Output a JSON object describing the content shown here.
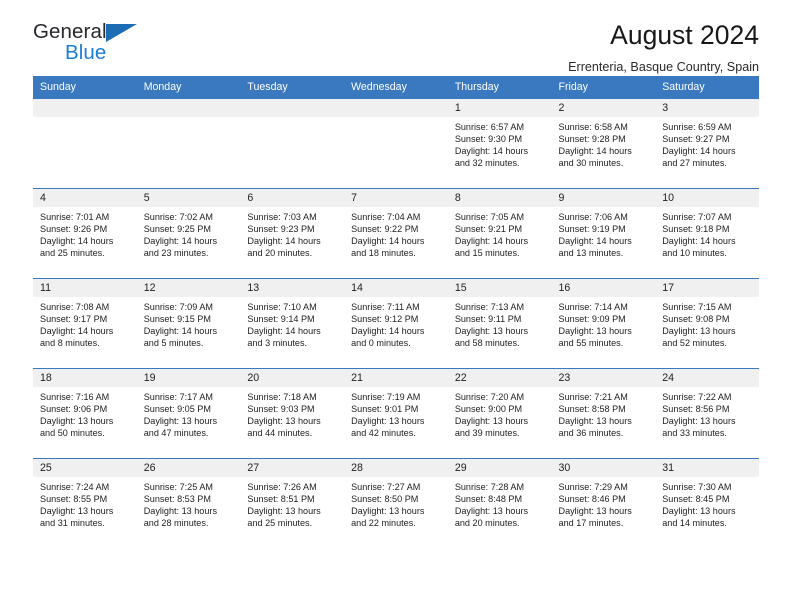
{
  "brand": {
    "name_top": "General",
    "name_bottom": "Blue",
    "triangle_color": "#1b6cb5",
    "blue_text_color": "#1b7ed6"
  },
  "header": {
    "month_title": "August 2024",
    "location": "Errenteria, Basque Country, Spain"
  },
  "theme": {
    "header_blue": "#3a78bf",
    "daynum_band": "#f0f0f0",
    "text": "#1f1f1f"
  },
  "weekdays": [
    "Sunday",
    "Monday",
    "Tuesday",
    "Wednesday",
    "Thursday",
    "Friday",
    "Saturday"
  ],
  "weeks": [
    [
      {
        "day": "",
        "sunrise": "",
        "sunset": "",
        "daylight_line1": "",
        "daylight_line2": "",
        "empty": true
      },
      {
        "day": "",
        "sunrise": "",
        "sunset": "",
        "daylight_line1": "",
        "daylight_line2": "",
        "empty": true
      },
      {
        "day": "",
        "sunrise": "",
        "sunset": "",
        "daylight_line1": "",
        "daylight_line2": "",
        "empty": true
      },
      {
        "day": "",
        "sunrise": "",
        "sunset": "",
        "daylight_line1": "",
        "daylight_line2": "",
        "empty": true
      },
      {
        "day": "1",
        "sunrise": "Sunrise: 6:57 AM",
        "sunset": "Sunset: 9:30 PM",
        "daylight_line1": "Daylight: 14 hours",
        "daylight_line2": "and 32 minutes."
      },
      {
        "day": "2",
        "sunrise": "Sunrise: 6:58 AM",
        "sunset": "Sunset: 9:28 PM",
        "daylight_line1": "Daylight: 14 hours",
        "daylight_line2": "and 30 minutes."
      },
      {
        "day": "3",
        "sunrise": "Sunrise: 6:59 AM",
        "sunset": "Sunset: 9:27 PM",
        "daylight_line1": "Daylight: 14 hours",
        "daylight_line2": "and 27 minutes."
      }
    ],
    [
      {
        "day": "4",
        "sunrise": "Sunrise: 7:01 AM",
        "sunset": "Sunset: 9:26 PM",
        "daylight_line1": "Daylight: 14 hours",
        "daylight_line2": "and 25 minutes."
      },
      {
        "day": "5",
        "sunrise": "Sunrise: 7:02 AM",
        "sunset": "Sunset: 9:25 PM",
        "daylight_line1": "Daylight: 14 hours",
        "daylight_line2": "and 23 minutes."
      },
      {
        "day": "6",
        "sunrise": "Sunrise: 7:03 AM",
        "sunset": "Sunset: 9:23 PM",
        "daylight_line1": "Daylight: 14 hours",
        "daylight_line2": "and 20 minutes."
      },
      {
        "day": "7",
        "sunrise": "Sunrise: 7:04 AM",
        "sunset": "Sunset: 9:22 PM",
        "daylight_line1": "Daylight: 14 hours",
        "daylight_line2": "and 18 minutes."
      },
      {
        "day": "8",
        "sunrise": "Sunrise: 7:05 AM",
        "sunset": "Sunset: 9:21 PM",
        "daylight_line1": "Daylight: 14 hours",
        "daylight_line2": "and 15 minutes."
      },
      {
        "day": "9",
        "sunrise": "Sunrise: 7:06 AM",
        "sunset": "Sunset: 9:19 PM",
        "daylight_line1": "Daylight: 14 hours",
        "daylight_line2": "and 13 minutes."
      },
      {
        "day": "10",
        "sunrise": "Sunrise: 7:07 AM",
        "sunset": "Sunset: 9:18 PM",
        "daylight_line1": "Daylight: 14 hours",
        "daylight_line2": "and 10 minutes."
      }
    ],
    [
      {
        "day": "11",
        "sunrise": "Sunrise: 7:08 AM",
        "sunset": "Sunset: 9:17 PM",
        "daylight_line1": "Daylight: 14 hours",
        "daylight_line2": "and 8 minutes."
      },
      {
        "day": "12",
        "sunrise": "Sunrise: 7:09 AM",
        "sunset": "Sunset: 9:15 PM",
        "daylight_line1": "Daylight: 14 hours",
        "daylight_line2": "and 5 minutes."
      },
      {
        "day": "13",
        "sunrise": "Sunrise: 7:10 AM",
        "sunset": "Sunset: 9:14 PM",
        "daylight_line1": "Daylight: 14 hours",
        "daylight_line2": "and 3 minutes."
      },
      {
        "day": "14",
        "sunrise": "Sunrise: 7:11 AM",
        "sunset": "Sunset: 9:12 PM",
        "daylight_line1": "Daylight: 14 hours",
        "daylight_line2": "and 0 minutes."
      },
      {
        "day": "15",
        "sunrise": "Sunrise: 7:13 AM",
        "sunset": "Sunset: 9:11 PM",
        "daylight_line1": "Daylight: 13 hours",
        "daylight_line2": "and 58 minutes."
      },
      {
        "day": "16",
        "sunrise": "Sunrise: 7:14 AM",
        "sunset": "Sunset: 9:09 PM",
        "daylight_line1": "Daylight: 13 hours",
        "daylight_line2": "and 55 minutes."
      },
      {
        "day": "17",
        "sunrise": "Sunrise: 7:15 AM",
        "sunset": "Sunset: 9:08 PM",
        "daylight_line1": "Daylight: 13 hours",
        "daylight_line2": "and 52 minutes."
      }
    ],
    [
      {
        "day": "18",
        "sunrise": "Sunrise: 7:16 AM",
        "sunset": "Sunset: 9:06 PM",
        "daylight_line1": "Daylight: 13 hours",
        "daylight_line2": "and 50 minutes."
      },
      {
        "day": "19",
        "sunrise": "Sunrise: 7:17 AM",
        "sunset": "Sunset: 9:05 PM",
        "daylight_line1": "Daylight: 13 hours",
        "daylight_line2": "and 47 minutes."
      },
      {
        "day": "20",
        "sunrise": "Sunrise: 7:18 AM",
        "sunset": "Sunset: 9:03 PM",
        "daylight_line1": "Daylight: 13 hours",
        "daylight_line2": "and 44 minutes."
      },
      {
        "day": "21",
        "sunrise": "Sunrise: 7:19 AM",
        "sunset": "Sunset: 9:01 PM",
        "daylight_line1": "Daylight: 13 hours",
        "daylight_line2": "and 42 minutes."
      },
      {
        "day": "22",
        "sunrise": "Sunrise: 7:20 AM",
        "sunset": "Sunset: 9:00 PM",
        "daylight_line1": "Daylight: 13 hours",
        "daylight_line2": "and 39 minutes."
      },
      {
        "day": "23",
        "sunrise": "Sunrise: 7:21 AM",
        "sunset": "Sunset: 8:58 PM",
        "daylight_line1": "Daylight: 13 hours",
        "daylight_line2": "and 36 minutes."
      },
      {
        "day": "24",
        "sunrise": "Sunrise: 7:22 AM",
        "sunset": "Sunset: 8:56 PM",
        "daylight_line1": "Daylight: 13 hours",
        "daylight_line2": "and 33 minutes."
      }
    ],
    [
      {
        "day": "25",
        "sunrise": "Sunrise: 7:24 AM",
        "sunset": "Sunset: 8:55 PM",
        "daylight_line1": "Daylight: 13 hours",
        "daylight_line2": "and 31 minutes."
      },
      {
        "day": "26",
        "sunrise": "Sunrise: 7:25 AM",
        "sunset": "Sunset: 8:53 PM",
        "daylight_line1": "Daylight: 13 hours",
        "daylight_line2": "and 28 minutes."
      },
      {
        "day": "27",
        "sunrise": "Sunrise: 7:26 AM",
        "sunset": "Sunset: 8:51 PM",
        "daylight_line1": "Daylight: 13 hours",
        "daylight_line2": "and 25 minutes."
      },
      {
        "day": "28",
        "sunrise": "Sunrise: 7:27 AM",
        "sunset": "Sunset: 8:50 PM",
        "daylight_line1": "Daylight: 13 hours",
        "daylight_line2": "and 22 minutes."
      },
      {
        "day": "29",
        "sunrise": "Sunrise: 7:28 AM",
        "sunset": "Sunset: 8:48 PM",
        "daylight_line1": "Daylight: 13 hours",
        "daylight_line2": "and 20 minutes."
      },
      {
        "day": "30",
        "sunrise": "Sunrise: 7:29 AM",
        "sunset": "Sunset: 8:46 PM",
        "daylight_line1": "Daylight: 13 hours",
        "daylight_line2": "and 17 minutes."
      },
      {
        "day": "31",
        "sunrise": "Sunrise: 7:30 AM",
        "sunset": "Sunset: 8:45 PM",
        "daylight_line1": "Daylight: 13 hours",
        "daylight_line2": "and 14 minutes."
      }
    ]
  ]
}
